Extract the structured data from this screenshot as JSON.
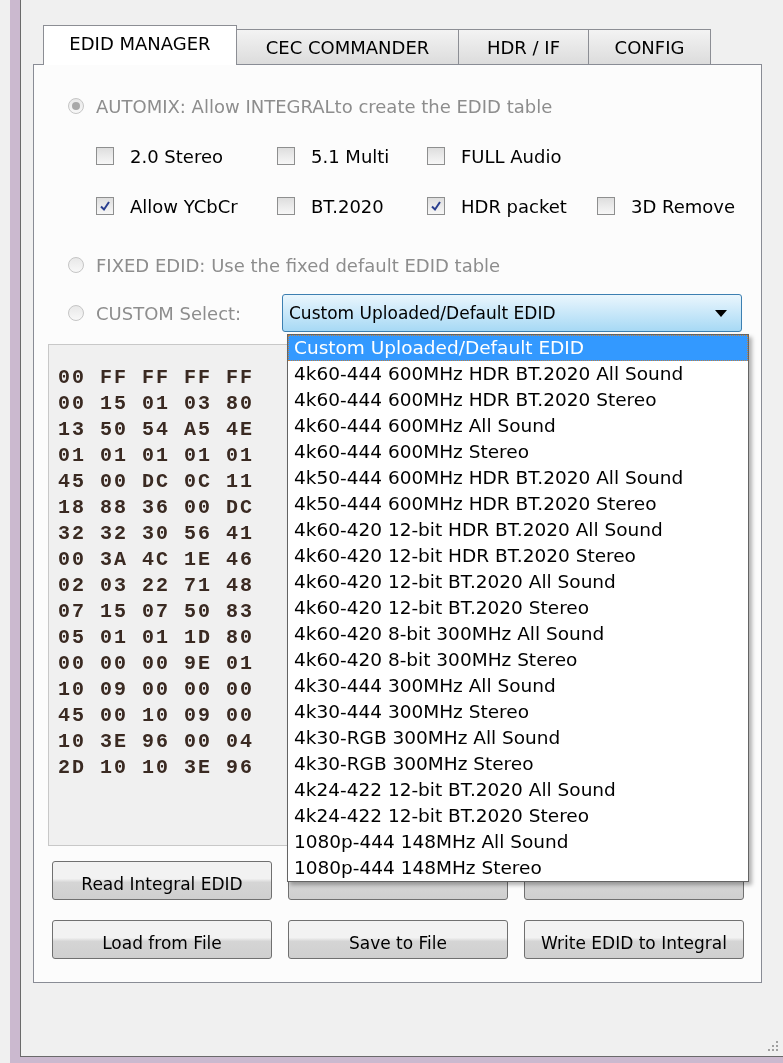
{
  "tabs": [
    {
      "label": "EDID MANAGER",
      "selected": true
    },
    {
      "label": "CEC COMMANDER",
      "selected": false
    },
    {
      "label": "HDR / IF",
      "selected": false
    },
    {
      "label": "CONFIG",
      "selected": false
    }
  ],
  "radios": [
    {
      "label": "AUTOMIX: Allow INTEGRALto create the EDID table",
      "selected": true,
      "disabled": true
    },
    {
      "label": "FIXED EDID: Use the fixed default EDID table",
      "selected": false,
      "disabled": true
    },
    {
      "label": "CUSTOM Select:",
      "selected": false,
      "disabled": true
    }
  ],
  "checkbox_rows": [
    [
      {
        "label": "2.0 Stereo",
        "checked": false
      },
      {
        "label": "5.1 Multi",
        "checked": false
      },
      {
        "label": "FULL Audio",
        "checked": false
      }
    ],
    [
      {
        "label": "Allow YCbCr",
        "checked": true
      },
      {
        "label": "BT.2020",
        "checked": false
      },
      {
        "label": "HDR packet",
        "checked": true
      },
      {
        "label": "3D Remove",
        "checked": false
      }
    ]
  ],
  "custom_select": {
    "value": "Custom Uploaded/Default EDID",
    "expanded": true,
    "options": [
      {
        "label": "Custom Uploaded/Default EDID",
        "selected": true
      },
      {
        "label": "4k60-444 600MHz HDR BT.2020 All Sound",
        "selected": false
      },
      {
        "label": "4k60-444 600MHz HDR BT.2020 Stereo",
        "selected": false
      },
      {
        "label": "4k60-444 600MHz All Sound",
        "selected": false
      },
      {
        "label": "4k60-444 600MHz Stereo",
        "selected": false
      },
      {
        "label": "4k50-444 600MHz HDR BT.2020 All Sound",
        "selected": false
      },
      {
        "label": "4k50-444 600MHz HDR BT.2020 Stereo",
        "selected": false
      },
      {
        "label": "4k60-420 12-bit HDR BT.2020 All Sound",
        "selected": false
      },
      {
        "label": "4k60-420 12-bit HDR BT.2020 Stereo",
        "selected": false
      },
      {
        "label": "4k60-420 12-bit BT.2020 All Sound",
        "selected": false
      },
      {
        "label": "4k60-420 12-bit BT.2020 Stereo",
        "selected": false
      },
      {
        "label": "4k60-420 8-bit 300MHz All Sound",
        "selected": false
      },
      {
        "label": "4k60-420 8-bit 300MHz Stereo",
        "selected": false
      },
      {
        "label": "4k30-444 300MHz All Sound",
        "selected": false
      },
      {
        "label": "4k30-444 300MHz Stereo",
        "selected": false
      },
      {
        "label": "4k30-RGB 300MHz All Sound",
        "selected": false
      },
      {
        "label": "4k30-RGB 300MHz Stereo",
        "selected": false
      },
      {
        "label": "4k24-422 12-bit BT.2020 All Sound",
        "selected": false
      },
      {
        "label": "4k24-422 12-bit BT.2020 Stereo",
        "selected": false
      },
      {
        "label": "1080p-444 148MHz All Sound",
        "selected": false
      },
      {
        "label": "1080p-444 148MHz Stereo",
        "selected": false
      }
    ]
  },
  "hex_rows": [
    "00 FF FF FF FF",
    "00 15 01 03 80",
    "13 50 54 A5 4E",
    "01 01 01 01 01",
    "45 00 DC 0C 11",
    "18 88 36 00 DC",
    "32 32 30 56 41",
    "00 3A 4C 1E 46",
    "02 03 22 71 48",
    "07 15 07 50 83",
    "05 01 01 1D 80",
    "00 00 00 9E 01",
    "10 09 00 00 00",
    "45 00 10 09 00",
    "10 3E 96 00 04",
    "2D 10 10 3E 96"
  ],
  "buttons": [
    {
      "kind": "labeled",
      "label": "Read Integral EDID"
    },
    {
      "kind": "covered"
    },
    {
      "kind": "covered"
    },
    {
      "kind": "labeled",
      "label": "Load from File"
    },
    {
      "kind": "labeled",
      "label": "Save to File"
    },
    {
      "kind": "labeled",
      "label": "Write EDID to Integral"
    }
  ]
}
